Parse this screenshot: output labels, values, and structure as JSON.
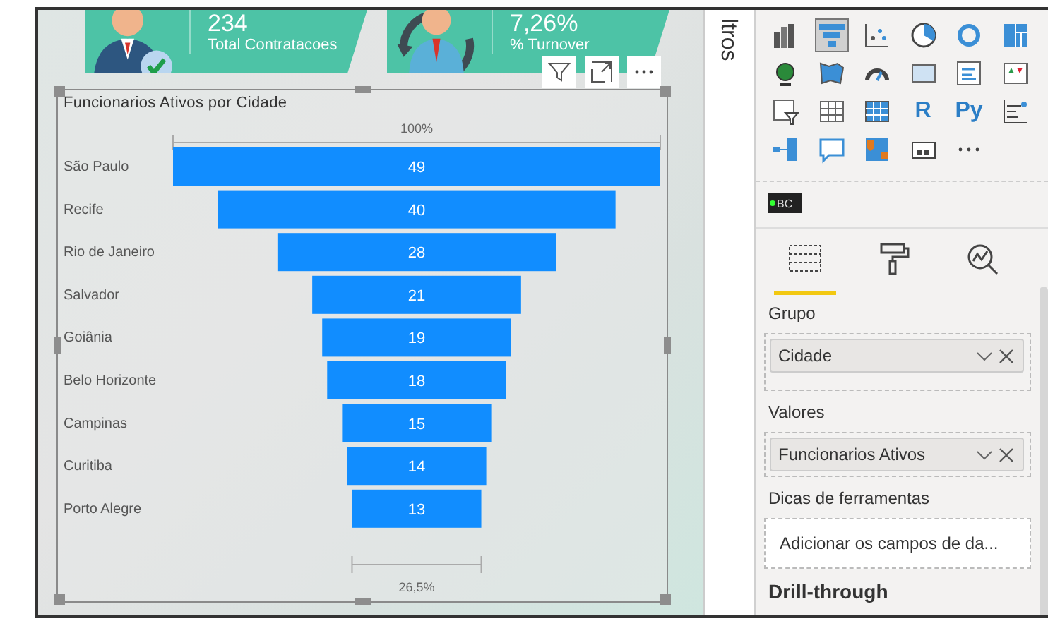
{
  "kpis": [
    {
      "kind": "hires",
      "value": "234",
      "label": "Total Contratacoes"
    },
    {
      "kind": "turnover",
      "value": "7,26%",
      "label": "% Turnover"
    }
  ],
  "visual": {
    "focused": true,
    "title": "Funcionarios Ativos por Cidade",
    "top_label": "100%",
    "bottom_label": "26,5%",
    "stages": [
      {
        "label": "São Paulo",
        "value": "49"
      },
      {
        "label": "Recife",
        "value": "40"
      },
      {
        "label": "Rio de Janeiro",
        "value": "28"
      },
      {
        "label": "Salvador",
        "value": "21"
      },
      {
        "label": "Goiânia",
        "value": "19"
      },
      {
        "label": "Belo Horizonte",
        "value": "18"
      },
      {
        "label": "Campinas",
        "value": "15"
      },
      {
        "label": "Curitiba",
        "value": "14"
      },
      {
        "label": "Porto Alegre",
        "value": "13"
      }
    ]
  },
  "filters_pane": {
    "title": "ltros"
  },
  "visualizations": [
    {
      "kind": "column",
      "selected": false
    },
    {
      "kind": "funnel",
      "selected": true
    },
    {
      "kind": "scatter",
      "selected": false
    },
    {
      "kind": "pie",
      "selected": false
    },
    {
      "kind": "donut",
      "selected": false
    },
    {
      "kind": "treemap",
      "selected": false
    },
    {
      "kind": "globe",
      "selected": false
    },
    {
      "kind": "map",
      "selected": false
    },
    {
      "kind": "gauge",
      "selected": false
    },
    {
      "kind": "card",
      "selected": false
    },
    {
      "kind": "multicard",
      "selected": false
    },
    {
      "kind": "kpi",
      "selected": false
    },
    {
      "kind": "slicer",
      "selected": false
    },
    {
      "kind": "table",
      "selected": false
    },
    {
      "kind": "matrix",
      "selected": false
    },
    {
      "kind": "letters",
      "label": "R",
      "selected": false
    },
    {
      "kind": "letters",
      "label": "Py",
      "selected": false
    },
    {
      "kind": "influencers",
      "selected": false
    },
    {
      "kind": "tree",
      "selected": false
    },
    {
      "kind": "bubble",
      "selected": false
    },
    {
      "kind": "flow",
      "selected": false
    },
    {
      "kind": "gears",
      "selected": false
    },
    {
      "kind": "more",
      "selected": false
    }
  ],
  "custom_visual": {
    "label": "BC"
  },
  "pane_tabs": [
    {
      "kind": "fields",
      "selected": true
    },
    {
      "kind": "format",
      "selected": false
    },
    {
      "kind": "analytics",
      "selected": false
    }
  ],
  "wells": [
    {
      "label": "Grupo",
      "fields": [
        "Cidade"
      ]
    },
    {
      "label": "Valores",
      "fields": [
        "Funcionarios Ativos"
      ]
    },
    {
      "label": "Dicas de ferramentas",
      "placeholder": "Adicionar os campos de da..."
    }
  ],
  "section_heading": "Drill-through"
}
